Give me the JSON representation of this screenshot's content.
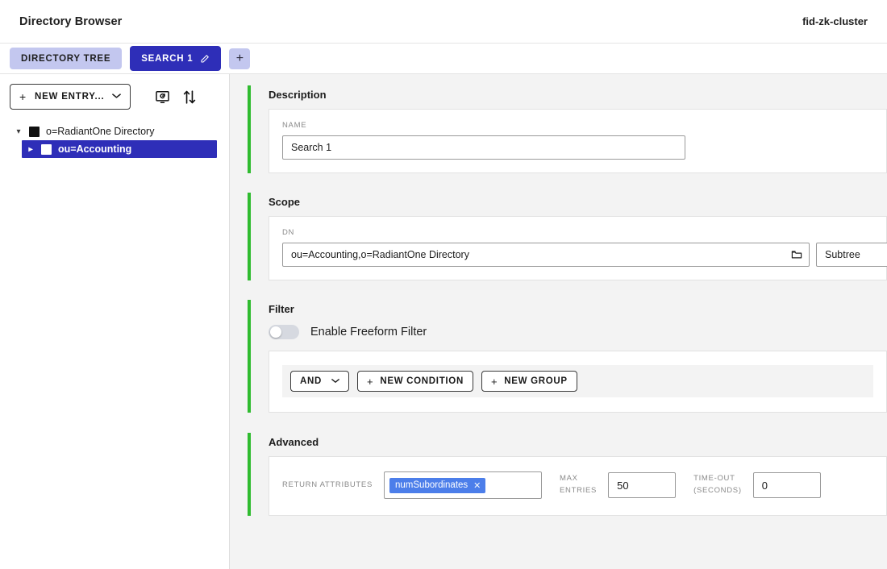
{
  "header": {
    "title": "Directory Browser",
    "cluster": "fid-zk-cluster"
  },
  "tabs": {
    "directory_tree": "DIRECTORY TREE",
    "search_1": "SEARCH 1",
    "add_label": "+",
    "edit_icon": "pencil-icon"
  },
  "sidebar": {
    "new_entry_label": "NEW ENTRY...",
    "refresh_icon": "monitor-refresh-icon",
    "sort_icon": "sort-updown-icon",
    "tree": [
      {
        "label": "o=RadiantOne Directory",
        "expanded": true,
        "selected": false
      },
      {
        "label": "ou=Accounting",
        "expanded": false,
        "selected": true
      }
    ]
  },
  "sections": {
    "description": {
      "title": "Description",
      "name_label": "NAME",
      "name_value": "Search 1",
      "name_placeholder": "Search 1"
    },
    "scope": {
      "title": "Scope",
      "dn_label": "DN",
      "dn_value": "ou=Accounting,o=RadiantOne Directory",
      "dn_placeholder": "ou=Accounting,o=RadiantOne Directory",
      "browse_icon": "folder-icon",
      "scope_selected": "Subtree"
    },
    "filter": {
      "title": "Filter",
      "freeform_toggle_label": "Enable Freeform Filter",
      "freeform_enabled": false,
      "operator": "AND",
      "new_condition": "NEW CONDITION",
      "new_group": "NEW GROUP"
    },
    "advanced": {
      "title": "Advanced",
      "return_attributes_label": "RETURN ATTRIBUTES",
      "return_attributes": [
        "numSubordinates"
      ],
      "max_entries_label_1": "MAX",
      "max_entries_label_2": "ENTRIES",
      "max_entries_value": "50",
      "timeout_label_1": "TIME-OUT",
      "timeout_label_2": "(SECONDS)",
      "timeout_value": "0"
    }
  },
  "colors": {
    "accent_green": "#2fbb2f",
    "tab_active": "#2e2eb8",
    "tab_inactive": "#c3c7ef",
    "chip_blue": "#4c7eea",
    "content_bg": "#f3f3f3"
  }
}
